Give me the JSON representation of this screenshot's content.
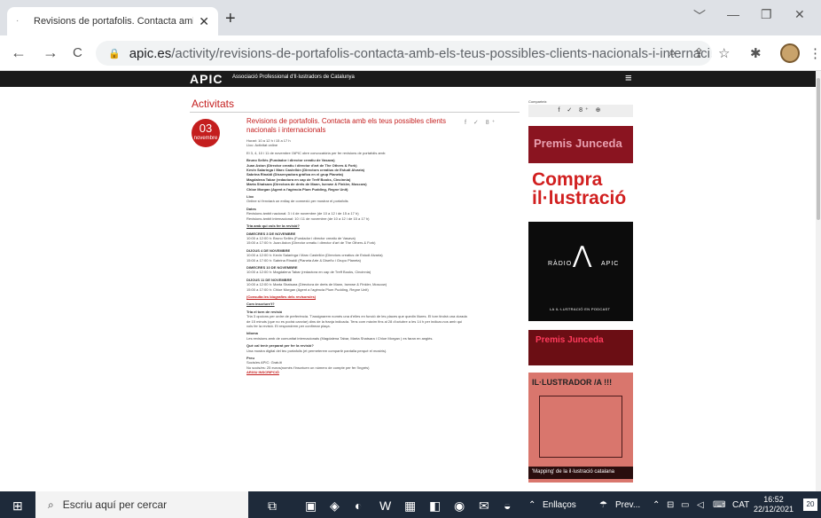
{
  "browser": {
    "tab_title": "Revisions de portafolis. Contacta amb els teu",
    "tab_close": "✕",
    "new_tab": "+",
    "url_host": "apic.es",
    "url_path": "/activity/revisions-de-portafolis-contacta-amb-els-teus-possibles-clients-nacionals-i-internaci...",
    "window_controls": [
      "﹀",
      "—",
      "❐",
      "✕"
    ],
    "nav": {
      "back": "←",
      "forward": "→",
      "reload": "C"
    }
  },
  "site": {
    "logo": "APIC",
    "logo_sub": "Associació Professional d'Il·lustradors de Catalunya",
    "menu_icon": "≡",
    "section": "Activitats",
    "date_day": "03",
    "date_month": "novembre",
    "article_title": "Revisions de portafolis. Contacta amb els teus possibles clients nacionals i internacionals",
    "share_icons": "f ✓ 8⁺",
    "article": {
      "p1": "Horari: 10 a 12 h i 15 a 17 h",
      "p2": "Lloc: Activitat online",
      "p3": "El 3, 4, 10 i 11 de novembre l'APIC obre convocatòria per fer revisions de portafolis amb:",
      "p4": "Bruno Sellés (Fundador i director creatiu de Vasava)",
      "p5": "Juan Aston (Director creatiu i director d'art de The Others & Fork)",
      "p6": "Kevin Salaringa i Marc Castellón (Directors creatius de Estudi Alvaria)",
      "p7": "Sabrina Rinaldi (Dissenyadora gràfica en el grup Planeta)",
      "p8": "Magdalena Tabar (redactora en cap de Treff Books, Cincinnia)",
      "p9": "Marta Shatsara (Directora de drets de Mann, Isenwe & Finkler, Moscow)",
      "p10": "Chloe Morgan (Agent a l'agència Plum Pudding, Regne Unit)",
      "h_lloc": "Lloc",
      "lloc_text": "Online si t'enviarà un enllaç de connexió per mostrar el portafolis",
      "h_dates": "Dates",
      "dates_1": "Revisions àmbit nacional: 3 i 4 de novembre (de 10 a 12 i de 15 a 17 h)",
      "dates_2": "Revisions àmbit internacional: 10 i 11 de novembre (de 10 a 12 i de 15 a 17 h)",
      "q_amb_qui": "Tria amb qui vols fer la revisió?",
      "h_d3": "DIMECRES 3 DE NOVEMBRE",
      "d3_1": "10:00 a 12:00 h: Bruno Sellés (Fundador i director creatiu de Vasava)",
      "d3_2": "15:00 a 17:00 h: Juan Aston (Director creatiu i director d'art de The Others & Fork)",
      "h_d4": "DIJOUS 4 DE NOVEMBRE",
      "d4_1": "10:00 a 12:00 h: Kevin Salaringa i Marc Castellón (Directors creatius de Estudi Alvaria)",
      "d4_2": "15:00 a 17:00 h: Sabrina Rinaldi (Planeta Arte & Diseño i Grupo Planeta)",
      "h_d10": "DIMECRES 10 DE NOVEMBRE",
      "d10_1": "10:00 a 12:00 h: Magdalena Tabar (redactora en cap de Treff Books, Cincinnia)",
      "h_d11": "DIJOUS 11 DE NOVEMBRE",
      "d11_1": "10:00 a 12:00 h: Marta Shatsara (Directora de drets de Mann, Isenwe & Finkler, Moscow)",
      "d11_2": "15:00 a 17:00 h: Chloe Morgan (Agent a l'agència Plum Pudding, Regne Unit)",
      "bio_link": "(Consulta les biografies dels revisors/es)",
      "q_inscriure": "Com inscriure't?",
      "h_torn": "Tria el torn de revisió",
      "torn_text": "Tria 3 opcions per ordre de preferència. T'assignarem només una d'elles en funció de les places que quedin lliures. El torn tindrà una durada de 15 minuts (que no es podrà canviar) dins de la franja indicada. Tens com màxim fins al 28 d'octubre a les 14 h per indicar-nos amb qui vols fer la revisió. Et respondrem per confirmar plaça.",
      "h_idioma": "Idioma",
      "idioma_text": "Les revisions amb de comunitat internacionals (Magdalena Tabar, Marta Shatsara i Chloe Morgan ) es faran en anglès.",
      "h_preparat": "Què cal tenir preparat per fer la revisió?",
      "preparat_text": "Una mostra digital del teu portafolis (et permeterem compartir pantalla perquè el mostris).",
      "h_preu": "Preu",
      "preu_1": "Socis/es APIC: Gratuït",
      "preu_2": "No socis/es: 25 euros(només t'inscriuen un número de compte per fer l'ingrés)",
      "preu_3": "ARXIU INSCRIPCIÓ"
    },
    "sidebar": {
      "comparteix": "Comparteix",
      "share_icons": "f ✓ 8⁺ ⊕",
      "ad_junceda": "Premis Junceda",
      "ad_compra_1": "Compra",
      "ad_compra_2": "il·lustració",
      "ad_radio_left": "RÀDIO",
      "ad_radio_right": "APIC",
      "ad_radio_caption": "LA IL·LUSTRACIÓ EN PODCAST",
      "ad_junceda2": "Premis Junceda",
      "ad_illustrador": "IL·LUSTRADOR /A !!!",
      "ad_mapping": "'Mapping' de la il·lustració catalana"
    }
  },
  "taskbar": {
    "search_placeholder": "Escriu aquí per cercar",
    "enllacos": "Enllaços",
    "weather": "Prev...",
    "lang": "CAT",
    "time": "16:52",
    "date": "22/12/2021",
    "notif": "20"
  }
}
